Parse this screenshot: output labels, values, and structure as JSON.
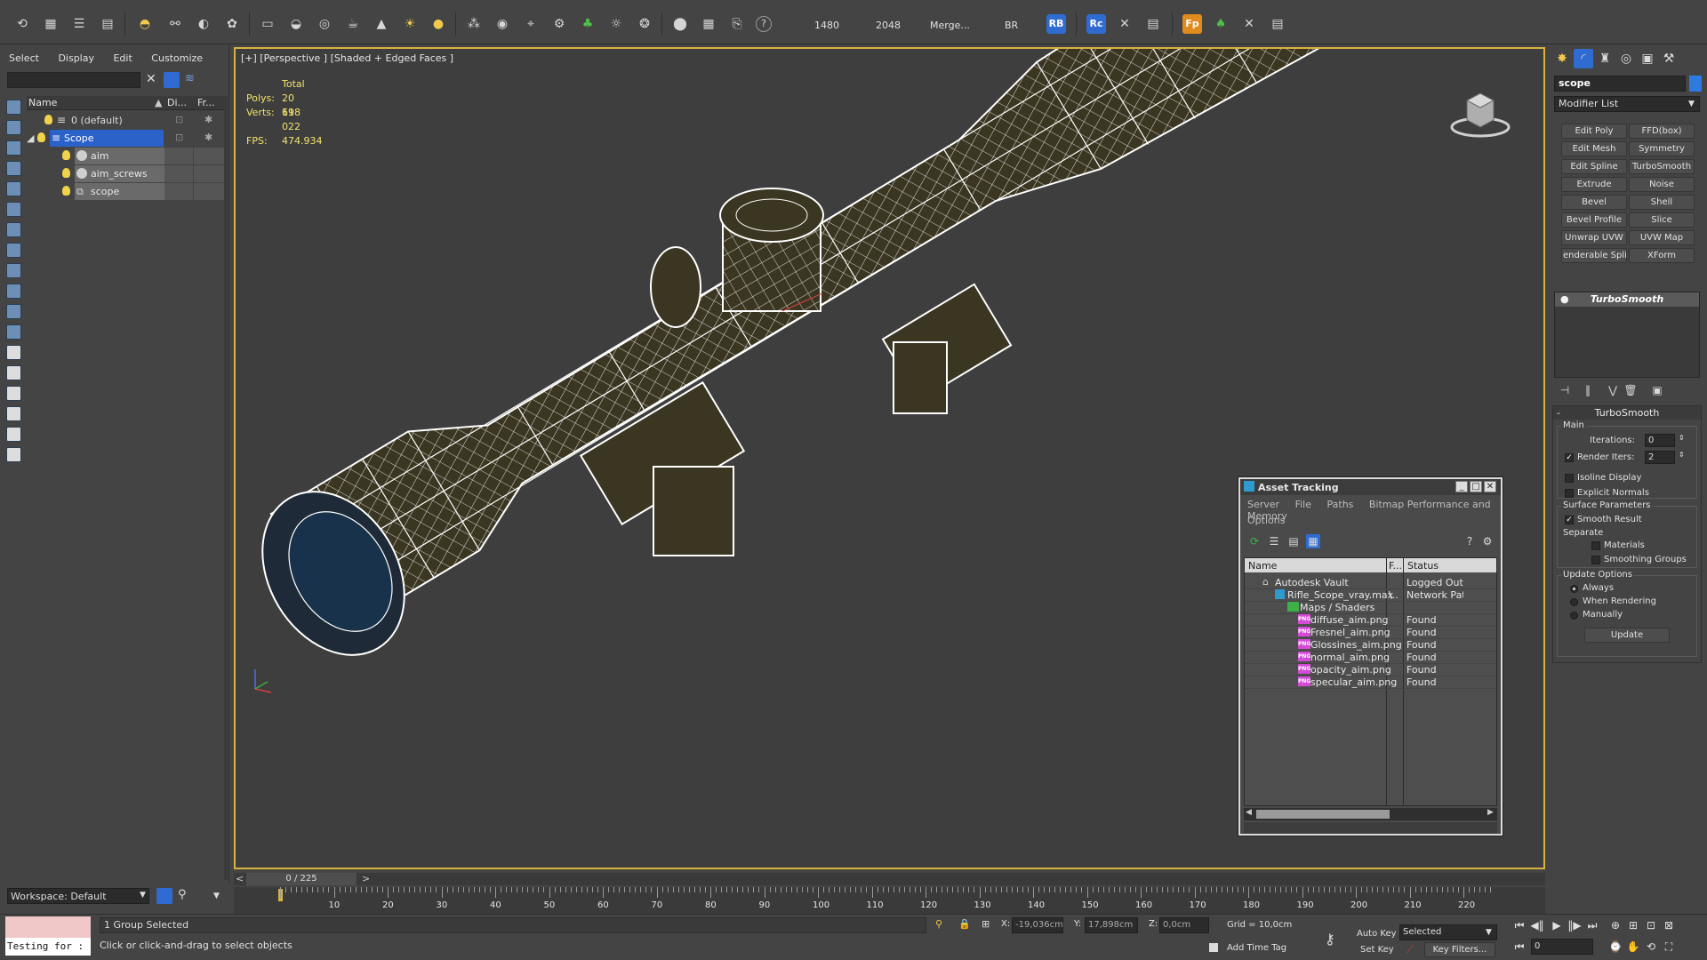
{
  "toolbar": {
    "num_a": "1480",
    "num_b": "2048",
    "merge_label": "Merge...",
    "br_label": "BR",
    "rb_label": "RB",
    "rc_label": "Rc",
    "fp_label": "Fp",
    "help_icon": "?"
  },
  "explorer": {
    "menu": [
      "Select",
      "Display",
      "Edit",
      "Customize"
    ],
    "columns": {
      "name": "Name",
      "display": "Di...",
      "freeze": "Fr..."
    },
    "rows": [
      {
        "name": "0 (default)"
      },
      {
        "name": "Scope"
      },
      {
        "name": "aim"
      },
      {
        "name": "aim_screws"
      },
      {
        "name": "scope"
      }
    ],
    "workspace": "Workspace: Default"
  },
  "viewport": {
    "label": "[+] [Perspective ] [Shaded + Edged Faces ]",
    "stats": {
      "total_label": "Total",
      "polys_label": "Polys:",
      "polys": "20 698",
      "verts_label": "Verts:",
      "verts": "11 022",
      "fps_label": "FPS:",
      "fps": "474.934"
    }
  },
  "asset_tracking": {
    "title": "Asset Tracking",
    "menu": [
      "Server",
      "File",
      "Paths",
      "Bitmap Performance and Memory"
    ],
    "menu2": "Options",
    "columns": {
      "name": "Name",
      "f": "F...",
      "status": "Status"
    },
    "rows": [
      {
        "name": "Autodesk Vault",
        "status": "Logged Out ..."
      },
      {
        "name": "Rifle_Scope_vray.max",
        "path": "\\..",
        "status": "Network Path"
      },
      {
        "name": "Maps / Shaders",
        "status": ""
      },
      {
        "name": "diffuse_aim.png",
        "status": "Found"
      },
      {
        "name": "Fresnel_aim.png",
        "status": "Found"
      },
      {
        "name": "Glossines_aim.png",
        "status": "Found"
      },
      {
        "name": "normal_aim.png",
        "status": "Found"
      },
      {
        "name": "opacity_aim.png",
        "status": "Found"
      },
      {
        "name": "specular_aim.png",
        "status": "Found"
      }
    ],
    "png_badge": "PNG"
  },
  "command_panel": {
    "object_name": "scope",
    "modifier_list": "Modifier List",
    "buttons": [
      "Edit Poly",
      "FFD(box)",
      "Edit Mesh",
      "Symmetry",
      "Edit Spline",
      "TurboSmooth",
      "Extrude",
      "Noise",
      "Bevel",
      "Shell",
      "Bevel Profile",
      "Slice",
      "Unwrap UVW",
      "UVW Map",
      "enderable Splin",
      "XForm"
    ],
    "stack_item": "TurboSmooth",
    "rollout": {
      "title": "TurboSmooth",
      "main": "Main",
      "iterations_label": "Iterations:",
      "iterations": "0",
      "render_iters_label": "Render Iters:",
      "render_iters": "2",
      "isoline": "Isoline Display",
      "explicit": "Explicit Normals",
      "surface": "Surface Parameters",
      "smooth_result": "Smooth Result",
      "separate": "Separate",
      "materials": "Materials",
      "smoothing_groups": "Smoothing Groups",
      "update_options": "Update Options",
      "always": "Always",
      "when_rendering": "When Rendering",
      "manually": "Manually",
      "update_button": "Update"
    }
  },
  "timeline": {
    "frame": "0 / 225",
    "ticks": [
      "10",
      "20",
      "30",
      "40",
      "50",
      "60",
      "70",
      "80",
      "90",
      "100",
      "110",
      "120",
      "130",
      "140",
      "150",
      "160",
      "170",
      "180",
      "190",
      "200",
      "210",
      "220"
    ],
    "prev": "<",
    "next": ">"
  },
  "status": {
    "maxscript": "Testing for :",
    "selection": "1 Group Selected",
    "prompt": "Click or click-and-drag to select objects",
    "x_label": "X:",
    "x": "-19,036cm",
    "y_label": "Y:",
    "y": "17,898cm",
    "z_label": "Z:",
    "z": "0,0cm",
    "grid": "Grid = 10,0cm",
    "add_time_tag": "Add Time Tag",
    "auto_key": "Auto Key",
    "set_key": "Set Key",
    "selected": "Selected",
    "key_filters": "Key Filters...",
    "frame_field": "0"
  },
  "colors": {
    "viewport_border": "#d7b23c",
    "selection_blue": "#2b62c9",
    "stats_yellow": "#f3e36a",
    "mesh_fill": "#3b3621"
  }
}
